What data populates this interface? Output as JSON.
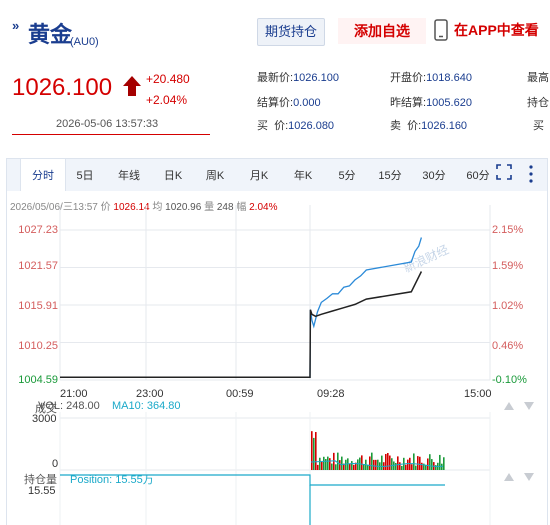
{
  "header": {
    "name": "黄金",
    "code": "(AU0)",
    "holdings_button": "期货持仓",
    "watchlist_button": "添加自选",
    "app_button": "在APP中查看"
  },
  "price": {
    "last": "1026.100",
    "change": "+20.480",
    "change_pct": "+2.04%",
    "timestamp": "2026-05-06 13:57:33"
  },
  "quote": {
    "latest_label": "最新价:",
    "latest": "1026.100",
    "settle_label": "结算价:",
    "settle": "0.000",
    "bid_label": "买  价:",
    "bid": "1026.080",
    "open_label": "开盘价:",
    "open": "1018.640",
    "prev_settle_label": "昨结算:",
    "prev_settle": "1005.620",
    "ask_label": "卖  价:",
    "ask": "1026.160",
    "high_label": "最高",
    "position_label": "持仓",
    "buy_vol_label": "买"
  },
  "tabs": [
    "分时",
    "5日",
    "年线",
    "日K",
    "周K",
    "月K",
    "年K",
    "5分",
    "15分",
    "30分",
    "60分"
  ],
  "info_row": {
    "date": "2026/05/06/三13:57",
    "price_label": "价",
    "price": "1026.14",
    "avg_label": "均",
    "avg": "1020.96",
    "vol_label": "量",
    "vol": "248",
    "range_label": "幅",
    "range": "2.04%"
  },
  "watermark": "新浪财经",
  "volume_panel": {
    "title": "成交",
    "vol_text": "VOL: 248.00",
    "ma_text": "MA10: 364.80",
    "max_tick": "3000",
    "zero_tick": "0"
  },
  "position_panel": {
    "title": "持仓量",
    "value_text": "Position: 15.55万",
    "tick": "15.55"
  },
  "colors": {
    "brand_blue": "#1a3d8f",
    "up_red": "#d40000",
    "price_line": "#2b8ad8",
    "avg_line": "#222222",
    "vol_up": "#d40000",
    "vol_down": "#1a9a3a",
    "position_line": "#1aa9c9"
  },
  "chart_data": {
    "type": "line",
    "y_ticks": [
      "1027.23",
      "1021.57",
      "1015.91",
      "1010.25",
      "1004.59"
    ],
    "y_pct_ticks": [
      "2.15%",
      "1.59%",
      "1.02%",
      "0.46%",
      "-0.10%"
    ],
    "x_ticks": [
      "21:00",
      "23:00",
      "00:59",
      "09:28",
      "15:00"
    ],
    "ylim": [
      1004.59,
      1027.23
    ],
    "series": [
      {
        "x": [
          "21:00",
          "22:00",
          "23:00",
          "00:00",
          "00:59",
          "09:00",
          "09:01",
          "09:05",
          "09:10",
          "09:20",
          "09:30",
          "09:45",
          "10:00",
          "10:15",
          "10:30",
          "10:45",
          "11:00",
          "11:15",
          "11:30",
          "13:30",
          "13:40",
          "13:50",
          "13:57"
        ],
        "values": [
          1005.0,
          1005.0,
          1005.0,
          1005.0,
          1005.0,
          1005.0,
          1015.2,
          1013.6,
          1012.7,
          1014.9,
          1016.3,
          1016.9,
          1017.6,
          1017.6,
          1018.6,
          1018.8,
          1019.7,
          1020.3,
          1021.2,
          1022.4,
          1024.0,
          1024.8,
          1026.1
        ]
      },
      {
        "x": [
          "21:00",
          "23:00",
          "00:59",
          "09:00",
          "09:01",
          "09:05",
          "09:15",
          "09:30",
          "10:00",
          "10:30",
          "11:00",
          "11:30",
          "13:30",
          "13:57"
        ],
        "values": [
          1005.0,
          1005.0,
          1005.0,
          1005.0,
          1015.2,
          1014.5,
          1014.2,
          1014.5,
          1015.0,
          1015.5,
          1016.0,
          1016.8,
          1017.9,
          1020.96
        ]
      }
    ]
  }
}
